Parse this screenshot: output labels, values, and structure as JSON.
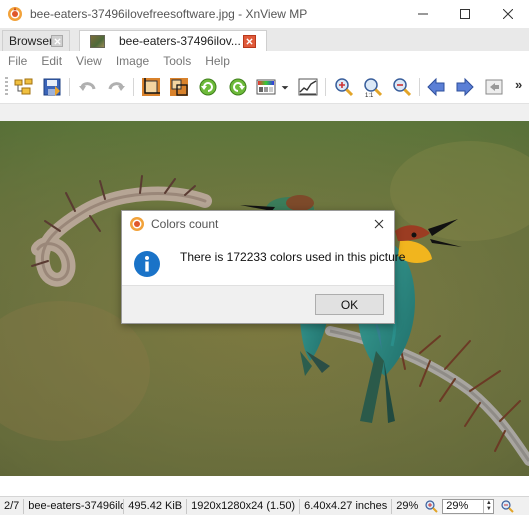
{
  "window": {
    "title": "bee-eaters-37496ilovefreesoftware.jpg - XnView MP",
    "minimize_icon": "minimize-icon",
    "maximize_icon": "maximize-icon",
    "close_icon": "close-icon"
  },
  "tabs": [
    {
      "label": "Browser",
      "active": false
    },
    {
      "label": "bee-eaters-37496ilov...",
      "active": true
    }
  ],
  "menu": [
    "File",
    "Edit",
    "View",
    "Image",
    "Tools",
    "Help"
  ],
  "toolbar": {
    "buttons": [
      "browser-folder-icon",
      "save-icon",
      "undo-icon",
      "redo-icon",
      "crop-icon",
      "resize-icon",
      "rotate-left-icon",
      "rotate-right-icon",
      "color-adjust-icon",
      "histogram-icon",
      "zoom-in-icon",
      "zoom-actual-icon",
      "zoom-out-icon",
      "previous-icon",
      "next-icon",
      "exit-fullscreen-icon"
    ],
    "overflow": "»"
  },
  "dialog": {
    "title": "Colors count",
    "message": "There is 172233 colors used in this picture",
    "ok_label": "OK",
    "icon": "info-icon"
  },
  "status": {
    "index": "2/7",
    "filename": "bee-eaters-37496ilov",
    "filesize": "495.42 KiB",
    "dimensions": "1920x1280x24 (1.50)",
    "print_size": "6.40x4.27 inches",
    "zoom_percent": "29%",
    "zoom_input": "29%"
  },
  "colors": {
    "accent_info": "#1a73c8",
    "ok_button": "#e1e1e1",
    "tab_close": "#e05a3a"
  }
}
